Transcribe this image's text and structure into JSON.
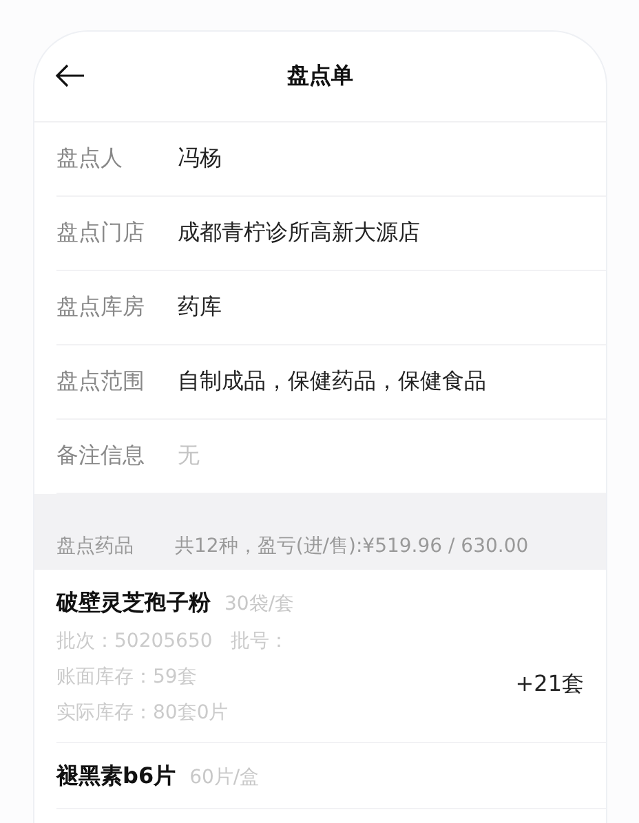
{
  "header": {
    "title": "盘点单"
  },
  "info": [
    {
      "label": "盘点人",
      "value": "冯杨",
      "muted": false
    },
    {
      "label": "盘点门店",
      "value": "成都青柠诊所高新大源店",
      "muted": false
    },
    {
      "label": "盘点库房",
      "value": "药库",
      "muted": false
    },
    {
      "label": "盘点范围",
      "value": "自制成品，保健药品，保健食品",
      "muted": false
    },
    {
      "label": "备注信息",
      "value": "无",
      "muted": true
    }
  ],
  "summary": {
    "label": "盘点药品",
    "text": "共12种，盈亏(进/售):¥519.96 / 630.00"
  },
  "items": [
    {
      "name": "破壁灵芝孢子粉",
      "spec": "30袋/套",
      "lines": [
        "批次：50205650   批号：",
        "账面库存：59套",
        "实际库存：80套0片"
      ],
      "diff": "+21套"
    },
    {
      "name": "褪黑素b6片",
      "spec": "60片/盒"
    }
  ]
}
